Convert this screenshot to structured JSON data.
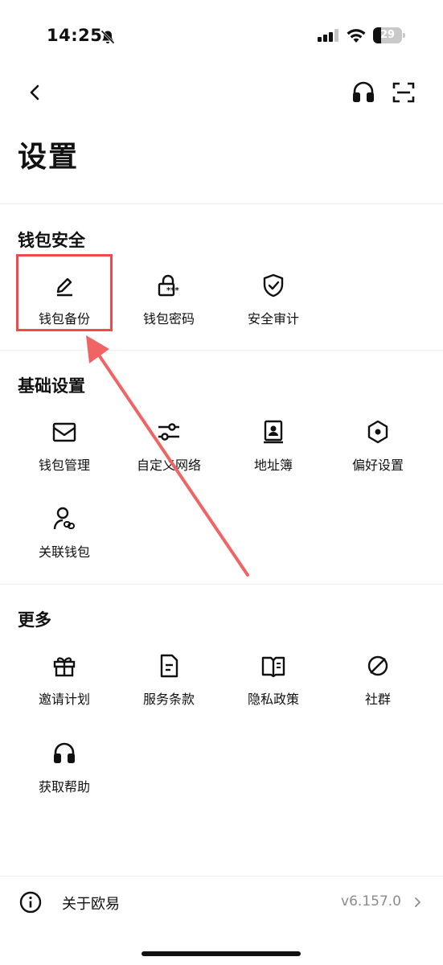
{
  "status": {
    "time": "14:25",
    "battery": "29",
    "battery_level": 0.29
  },
  "nav": {
    "back_icon": "chevron-left-icon",
    "support_icon": "headset-icon",
    "scan_icon": "scan-icon"
  },
  "page": {
    "title": "设置"
  },
  "sections": {
    "wallet_security": {
      "title": "钱包安全",
      "items": [
        {
          "label": "钱包备份",
          "icon": "pencil-icon"
        },
        {
          "label": "钱包密码",
          "icon": "lock-password-icon"
        },
        {
          "label": "安全审计",
          "icon": "shield-check-icon"
        }
      ]
    },
    "basic": {
      "title": "基础设置",
      "items": [
        {
          "label": "钱包管理",
          "icon": "wallet-icon"
        },
        {
          "label": "自定义网络",
          "icon": "sliders-icon"
        },
        {
          "label": "地址簿",
          "icon": "contact-book-icon"
        },
        {
          "label": "偏好设置",
          "icon": "hexagon-settings-icon"
        },
        {
          "label": "关联钱包",
          "icon": "user-link-icon"
        }
      ]
    },
    "more": {
      "title": "更多",
      "items": [
        {
          "label": "邀请计划",
          "icon": "gift-icon"
        },
        {
          "label": "服务条款",
          "icon": "document-icon"
        },
        {
          "label": "隐私政策",
          "icon": "book-icon"
        },
        {
          "label": "社群",
          "icon": "planet-icon"
        },
        {
          "label": "获取帮助",
          "icon": "headset-icon"
        }
      ]
    }
  },
  "about": {
    "label": "关于欧易",
    "version": "v6.157.0",
    "icon": "info-icon"
  },
  "annotation": {
    "box_color": "#ef4b4b",
    "arrow_color": "#f06464"
  }
}
